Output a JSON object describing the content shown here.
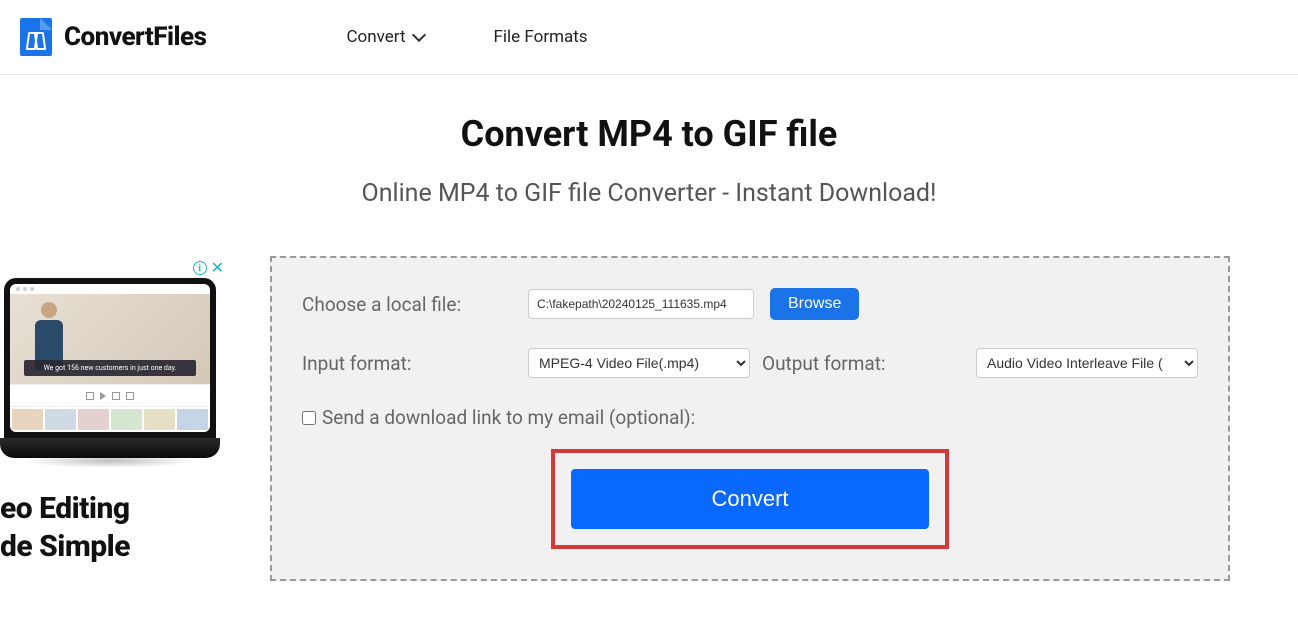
{
  "header": {
    "brand": "ConvertFiles",
    "nav": {
      "convert": "Convert",
      "formats": "File Formats"
    }
  },
  "page": {
    "title": "Convert MP4 to GIF file",
    "subtitle": "Online MP4 to GIF file Converter - Instant Download!"
  },
  "ad": {
    "caption": "We got 156 new customers in just one day.",
    "line1": "eo Editing",
    "line2": "de Simple"
  },
  "form": {
    "choose_label": "Choose a local file:",
    "file_value": "C:\\fakepath\\20240125_111635.mp4",
    "browse": "Browse",
    "input_label": "Input format:",
    "input_selected": "MPEG-4 Video File(.mp4)",
    "output_label": "Output format:",
    "output_selected": "Audio Video Interleave File (",
    "email_label": "Send a download link to my email (optional):",
    "convert": "Convert"
  }
}
